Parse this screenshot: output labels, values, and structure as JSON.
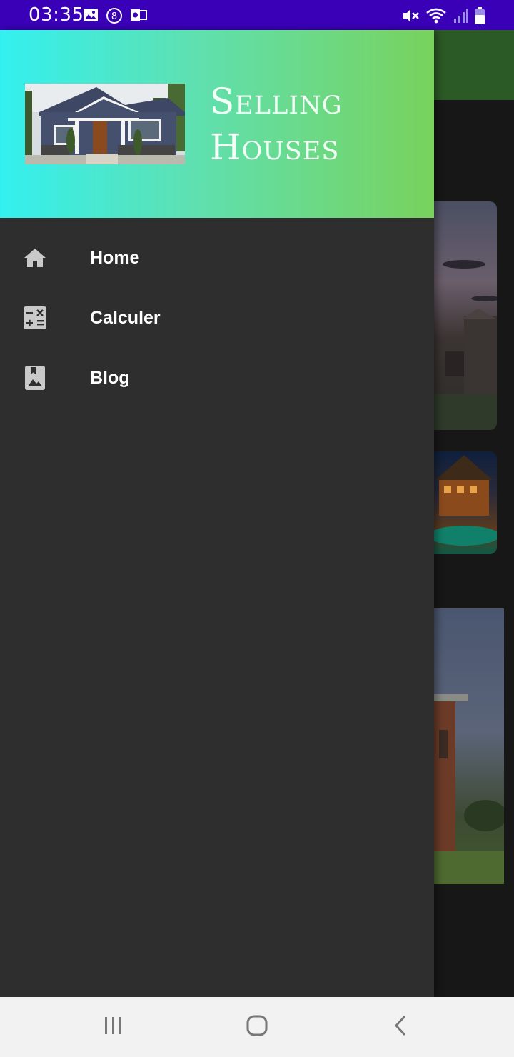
{
  "status_bar": {
    "time": "03:35",
    "left_icons": [
      "image-icon",
      "notification-8-icon",
      "outlook-icon"
    ],
    "right_icons": [
      "mute-vibrate-icon",
      "wifi-icon",
      "signal-icon",
      "battery-icon"
    ]
  },
  "drawer": {
    "header": {
      "title_line1": "Selling",
      "title_line2": "Houses",
      "image": "house-photo"
    },
    "items": [
      {
        "label": "Home",
        "icon": "home-icon"
      },
      {
        "label": "Calculer",
        "icon": "calculator-icon"
      },
      {
        "label": "Blog",
        "icon": "photo-bookmark-icon"
      }
    ]
  },
  "nav_bar": {
    "buttons": [
      "recent-apps-icon",
      "home-circle-icon",
      "back-icon"
    ]
  },
  "colors": {
    "status_bar": "#3a00b8",
    "drawer_bg": "#2e2e2e",
    "header_gradient_start": "#33f0ef",
    "header_gradient_end": "#78d25c",
    "app_bar": "#2c5a26"
  }
}
